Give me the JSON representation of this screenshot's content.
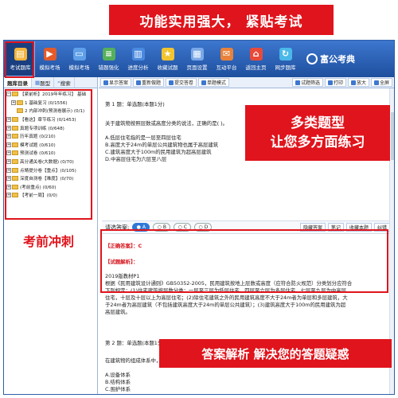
{
  "banners": {
    "top": "功能实用强大， 紧贴考试",
    "question_types": [
      "多类题型",
      "让您多方面练习"
    ],
    "sprint": "考前冲刺",
    "analysis": "答案解析  解决您的答题疑惑"
  },
  "toolbar": {
    "items": [
      {
        "label": "考试题库",
        "icon": "book-icon",
        "color": "#f3b43a"
      },
      {
        "label": "模拟考场",
        "icon": "play-icon",
        "color": "#e35b2a"
      },
      {
        "label": "模拟考场",
        "icon": "monitor-icon",
        "color": "#5fa0e8"
      },
      {
        "label": "错题强化",
        "icon": "list-icon",
        "color": "#56b05a"
      },
      {
        "label": "进度分析",
        "icon": "chart-icon",
        "color": "#4a8ae0"
      },
      {
        "label": "收藏试题",
        "icon": "star-icon",
        "color": "#f2c430"
      },
      {
        "label": "页面设置",
        "icon": "page-icon",
        "color": "#7aa8e8"
      },
      {
        "label": "互动平台",
        "icon": "chat-icon",
        "color": "#e8823a"
      },
      {
        "label": "返回主页",
        "icon": "home-icon",
        "color": "#e84a3a"
      },
      {
        "label": "网步题库",
        "icon": "sync-icon",
        "color": "#4ab8e8"
      }
    ],
    "brand": "富公考典"
  },
  "left": {
    "tabs": [
      "题库目录",
      "题型",
      "搜索"
    ],
    "tree": [
      "【紧前析】2019年年练习】 基础",
      "1 基础复习 (0/1556)",
      "2 内部冲刺(预测卷展示) (0/1)",
      "【看这】章节练习 (0/1453)",
      "真题专项训练 (0/648)",
      "历年真题 (0/210)",
      "模考试题 (0/610)",
      "预测试卷 (0/610)",
      "高分通关卷(大数据) (0/70)",
      "点睛提分卷【重点】(0/105)",
      "深度自测卷【难度】(0/70)",
      "(考前重点) (0/60)",
      "【考前一周】(0/0)"
    ]
  },
  "main": {
    "tools": [
      "显示答案",
      "重新做题",
      "提交答卷",
      "单题模式"
    ],
    "tools_right": [
      "试题筛选",
      "打印",
      "放大",
      "全屏"
    ],
    "q1_header": "第 1 题：单选题(本题1分)",
    "q1_text": "关于建筑物按照层数或高度分类的说法，正确的是( )。",
    "q1_options": [
      "A.低层住宅指的是一层至四层住宅",
      "B.高度大于24m的单层公共建筑物也属于高层建筑",
      "C.建筑高度大于100m的民用建筑为超高层建筑",
      "D.中高层住宅为六层至八层"
    ],
    "answer_prompt": "请选答案:",
    "choices": [
      "A",
      "B",
      "C",
      "D"
    ],
    "answer_buttons": [
      "隐藏答案",
      "笔记",
      "收藏本题",
      "纠错"
    ],
    "correct_label": "【正确答案】：C",
    "analysis_label": "【试题解析】：",
    "analysis_text": [
      "2019版教材P1",
      "根据《民用建筑设计通则》GB50352-2005，民用建筑按地上层数或高度（应符合防火规范）分类划分应符合",
      "下列规定：(1)住宅建筑按层数分类：一层至三层为低层住宅，四层至六层为多层住宅，七层至九层为中高层",
      "住宅，十层及十层以上为高层住宅；(2)除住宅建筑之外的民用建筑高度不大于24m者为单层和多层建筑，大",
      "于24m者为高层建筑（不包括建筑高度大于24m的单层公共建筑）；(3)建筑高度大于100m的民用建筑为超",
      "高层建筑。"
    ],
    "q2_header": "第 2 题：单选题(本题1分)",
    "q2_text": "在建筑物的组成体系中，能够保证使用人群的安全性和私密性的是( )。",
    "q2_options": [
      "A.设备体系",
      "B.结构体系",
      "C.围护体系"
    ]
  }
}
